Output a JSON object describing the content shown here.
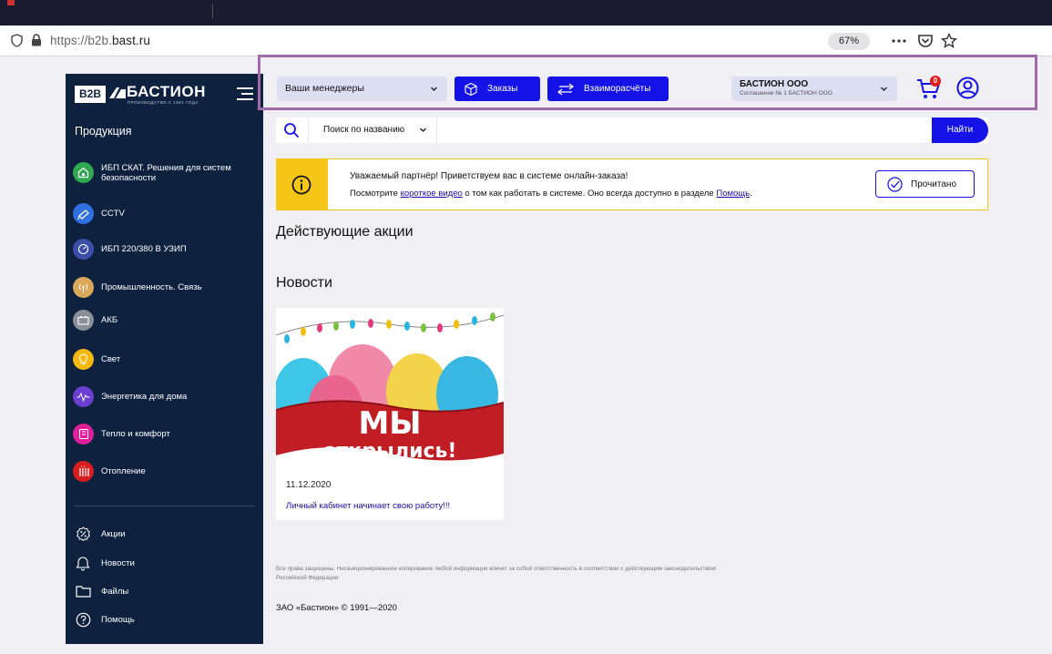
{
  "browser": {
    "url_prefix": "https://b2b.",
    "url_host": "bast.ru",
    "zoom": "67%"
  },
  "sidebar": {
    "logo_badge": "B2B",
    "logo_text": "БАСТИОН",
    "logo_sub": "ПРОИЗВОДСТВО С 1991 ГОДА",
    "section_title": "Продукция",
    "items": [
      {
        "label": "ИБП СКАТ. Решения для систем безопасности",
        "color": "#2fa84f"
      },
      {
        "label": "CCTV",
        "color": "#2f6fe0"
      },
      {
        "label": "ИБП 220/380 В УЗИП",
        "color": "#3b4fa8"
      },
      {
        "label": "Промышленность. Связь",
        "color": "#d9a85a"
      },
      {
        "label": "АКБ",
        "color": "#8a8f99"
      },
      {
        "label": "Свет",
        "color": "#f5b80f"
      },
      {
        "label": "Энергетика для дома",
        "color": "#6b3fd1"
      },
      {
        "label": "Тепло и комфорт",
        "color": "#e0209a"
      },
      {
        "label": "Отопление",
        "color": "#d81e1e"
      }
    ],
    "links": [
      {
        "label": "Акции",
        "icon": "percent-icon"
      },
      {
        "label": "Новости",
        "icon": "bell-icon"
      },
      {
        "label": "Файлы",
        "icon": "folder-icon"
      },
      {
        "label": "Помощь",
        "icon": "help-icon"
      }
    ]
  },
  "header": {
    "managers_label": "Ваши менеджеры",
    "orders_label": "Заказы",
    "settlements_label": "Взаиморасчёты",
    "company_name": "БАСТИОН ООО",
    "agreement": "Соглашение № 1 БАСТИОН ООО",
    "cart_count": "0"
  },
  "search": {
    "mode": "Поиск по названию",
    "placeholder": "",
    "button": "Найти"
  },
  "notice": {
    "title": "Уважаемый партнёр! Приветствуем вас в системе онлайн-заказа!",
    "text_before": "Посмотрите ",
    "video_link": "короткое видео",
    "text_middle": " о том как работать в системе. Оно всегда доступно в разделе ",
    "help_link": "Помощь",
    "text_after": ".",
    "read_button": "Прочитано"
  },
  "sections": {
    "promotions": "Действующие акции",
    "news": "Новости"
  },
  "news": [
    {
      "image_line1": "МЫ",
      "image_line2": "открылись!",
      "date": "11.12.2020",
      "title": "Личный кабинет начинает свою работу!!!"
    }
  ],
  "footer": {
    "rights": "Все права защищены. Несанкционированное копирование любой информации влечет за собой ответственность в соответствии с действующим законодательством Российской Федерации",
    "copyright": "ЗАО «Бастион» © 1991—2020"
  },
  "colors": {
    "sidebar_bg": "#0e2240",
    "primary_blue": "#1412e6",
    "highlight_frame": "#a26aa8",
    "notice_yellow": "#f5c518"
  }
}
